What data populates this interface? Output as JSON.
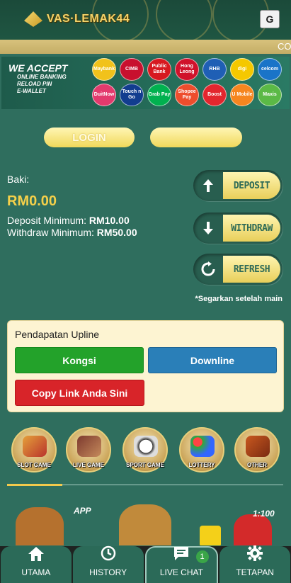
{
  "header": {
    "logo_text": "VAS·LEMAK44",
    "translate_icon": "google-translate-icon"
  },
  "marquee": {
    "text": "CO"
  },
  "banner": {
    "title": "WE ACCEPT",
    "lines": [
      "ONLINE BANKING",
      "RELOAD PIN",
      "E-WALLET"
    ],
    "banks": [
      {
        "name": "Maybank",
        "color": "#f1c21b"
      },
      {
        "name": "CIMB",
        "color": "#c8102e"
      },
      {
        "name": "Public Bank",
        "color": "#d71920"
      },
      {
        "name": "Hong Leong",
        "color": "#d0112b"
      },
      {
        "name": "RHB",
        "color": "#1f5fb5"
      },
      {
        "name": "digi",
        "color": "#f5c800"
      },
      {
        "name": "celcom",
        "color": "#1a74c8"
      },
      {
        "name": "DuitNow",
        "color": "#e33a6d"
      },
      {
        "name": "Touch n Go",
        "color": "#123d8f"
      },
      {
        "name": "Grab Pay",
        "color": "#00b14f"
      },
      {
        "name": "Shopee Pay",
        "color": "#ee4d2d"
      },
      {
        "name": "Boost",
        "color": "#e3262e"
      },
      {
        "name": "U Mobile",
        "color": "#f6861f"
      },
      {
        "name": "Maxis",
        "color": "#5bb946"
      }
    ]
  },
  "auth": {
    "login": "LOGIN",
    "register": ""
  },
  "wallet": {
    "balance_label": "Baki:",
    "balance": "RM0.00",
    "deposit_min_label": "Deposit Minimum:",
    "deposit_min": "RM10.00",
    "withdraw_min_label": "Withdraw Minimum:",
    "withdraw_min": "RM50.00"
  },
  "actions": {
    "deposit": "DEPOSIT",
    "withdraw": "WITHDRAW",
    "refresh": "REFRESH",
    "note": "*Segarkan setelah main"
  },
  "upline": {
    "title": "Pendapatan Upline",
    "kongsi": "Kongsi",
    "downline": "Downline",
    "copy_link": "Copy Link Anda Sini"
  },
  "categories": [
    "SLOT GAME",
    "LIVE GAME",
    "SPORT GAME",
    "LOTTERY",
    "OTHER"
  ],
  "promo": {
    "app": "APP",
    "ratio": "1:100"
  },
  "bottom_nav": [
    {
      "label": "UTAMA",
      "icon": "home-icon"
    },
    {
      "label": "HISTORY",
      "icon": "clock-icon"
    },
    {
      "label": "LIVE CHAT",
      "icon": "chat-icon",
      "badge": "1"
    },
    {
      "label": "TETAPAN",
      "icon": "gear-icon"
    }
  ]
}
